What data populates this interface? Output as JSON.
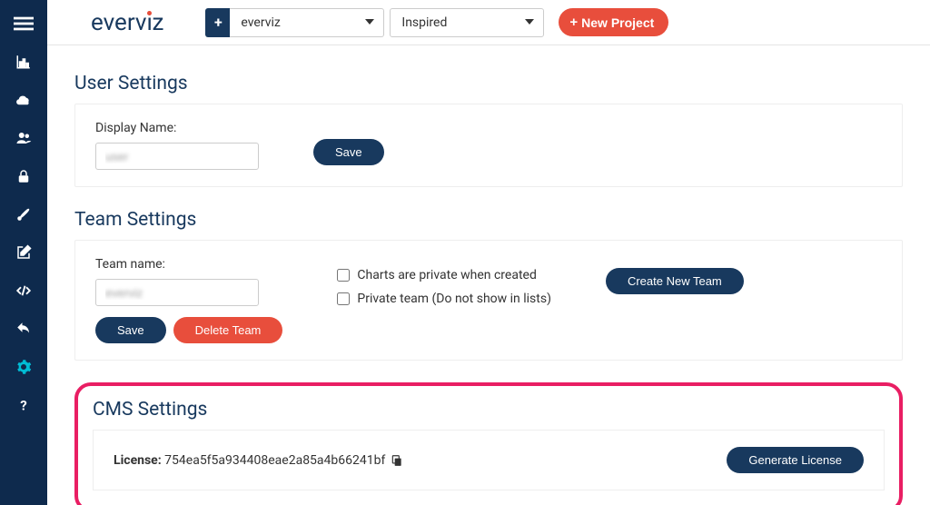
{
  "brand": {
    "name_pre": "everv",
    "name_post": "z"
  },
  "topbar": {
    "team_dd": "everviz",
    "theme_dd": "Inspired",
    "new_project": "New Project"
  },
  "sections": {
    "user": {
      "title": "User Settings",
      "display_name_label": "Display Name:",
      "display_name_value": "user",
      "save": "Save"
    },
    "team": {
      "title": "Team Settings",
      "team_name_label": "Team name:",
      "team_name_value": "everviz",
      "check_private_charts": "Charts are private when created",
      "check_private_team": "Private team (Do not show in lists)",
      "create_team": "Create New Team",
      "save": "Save",
      "delete": "Delete Team"
    },
    "cms": {
      "title": "CMS Settings",
      "license_label": "License:",
      "license_value": "754ea5f5a934408eae2a85a4b66241bf",
      "generate": "Generate License"
    }
  }
}
